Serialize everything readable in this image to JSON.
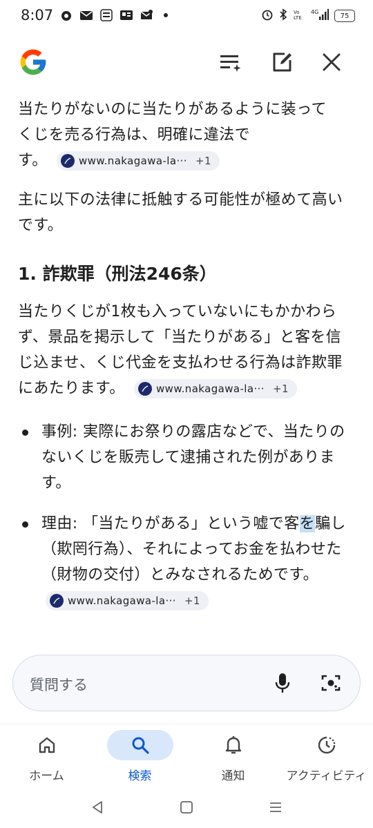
{
  "status_bar": {
    "time": "8:07",
    "battery": "75",
    "network": "4G"
  },
  "top_bar": {
    "logo": "google-g-logo",
    "icons": [
      "list-sparkle-icon",
      "edit-note-icon",
      "close-icon"
    ]
  },
  "answer": {
    "intro_line1": "当たりがないのに当たりがあるように装って",
    "intro_line2": "くじを売る行為は、明確に違法で",
    "intro_line3": "す。",
    "intro_chip": {
      "site": "www.nakagawa-la···",
      "more": "+1"
    },
    "lead": "主に以下の法律に抵触する可能性が極めて高いです。",
    "section1_title": "1. 詐欺罪（刑法246条）",
    "section1_body": "当たりくじが1枚も入っていないにもかかわらず、景品を掲示して「当たりがある」と客を信じ込ませ、くじ代金を支払わせる行為は詐欺罪にあたります。",
    "section1_chip": {
      "site": "www.nakagawa-la···",
      "more": "+1"
    },
    "bullets": [
      {
        "text": "事例: 実際にお祭りの露店などで、当たりのないくじを販売して逮捕された例があります。"
      },
      {
        "before": "理由: 「当たりがある」という嘘で客",
        "highlight": "を",
        "after": "騙し（欺罔行為）、それによってお金を払わせた（財物の交付）とみなされるためです。"
      }
    ],
    "bullet_chip": {
      "site": "www.nakagawa-la···",
      "more": "+1"
    }
  },
  "search": {
    "placeholder": "質問する"
  },
  "bottom_nav": [
    {
      "label": "ホーム",
      "icon": "home-icon",
      "active": false
    },
    {
      "label": "検索",
      "icon": "search-icon",
      "active": true
    },
    {
      "label": "通知",
      "icon": "bell-icon",
      "active": false
    },
    {
      "label": "アクティビティ",
      "icon": "activity-icon",
      "active": false
    }
  ],
  "colors": {
    "accent": "#0b57d0",
    "active_pill": "#d9e7fb",
    "chip_bg": "#eef0f5",
    "highlight": "#c3e1f7"
  }
}
